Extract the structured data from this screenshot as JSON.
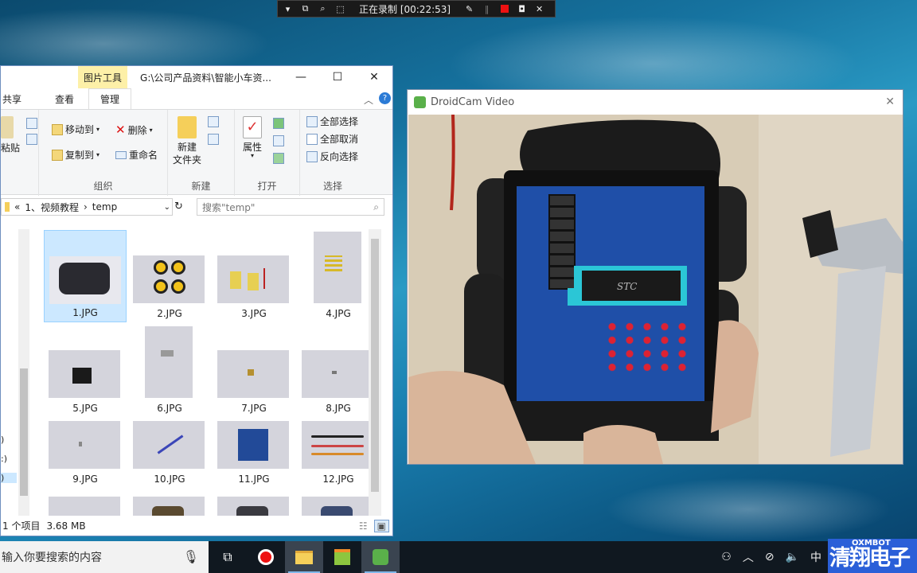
{
  "recorder": {
    "status": "正在录制 [00:22:53]"
  },
  "explorer": {
    "context_tab": "图片工具",
    "title": "G:\\公司产品资料\\智能小车资...",
    "tabs": [
      {
        "label": "共享"
      },
      {
        "label": "查看"
      },
      {
        "label": "管理"
      }
    ],
    "ribbon": {
      "paste": "粘贴",
      "move_to": "移动到",
      "copy_to": "复制到",
      "delete": "删除",
      "rename": "重命名",
      "group_organize": "组织",
      "new_folder_l1": "新建",
      "new_folder_l2": "文件夹",
      "group_new": "新建",
      "properties": "属性",
      "group_open": "打开",
      "select_all": "全部选择",
      "select_none": "全部取消",
      "invert": "反向选择",
      "group_select": "选择"
    },
    "address": {
      "sep": "«",
      "parent": "1、视频教程",
      "current": "temp"
    },
    "search_placeholder": "搜索\"temp\"",
    "files": [
      {
        "name": "1.JPG"
      },
      {
        "name": "2.JPG"
      },
      {
        "name": "3.JPG"
      },
      {
        "name": "4.JPG"
      },
      {
        "name": "5.JPG"
      },
      {
        "name": "6.JPG"
      },
      {
        "name": "7.JPG"
      },
      {
        "name": "8.JPG"
      },
      {
        "name": "9.JPG"
      },
      {
        "name": "10.JPG"
      },
      {
        "name": "11.JPG"
      },
      {
        "name": "12.JPG"
      }
    ],
    "status": {
      "selected": "1 个项目",
      "size": "3.68 MB"
    }
  },
  "droidcam": {
    "title": "DroidCam Video",
    "chip_label": "STC"
  },
  "taskbar": {
    "search_placeholder": "输入你要搜索的内容",
    "ime": "中"
  },
  "logo": {
    "top": "OXMBOT",
    "main": "清翔电子"
  },
  "colors": {
    "accent": "#2a5fd8",
    "board": "#1f4fa8",
    "selection": "#cce8ff"
  }
}
